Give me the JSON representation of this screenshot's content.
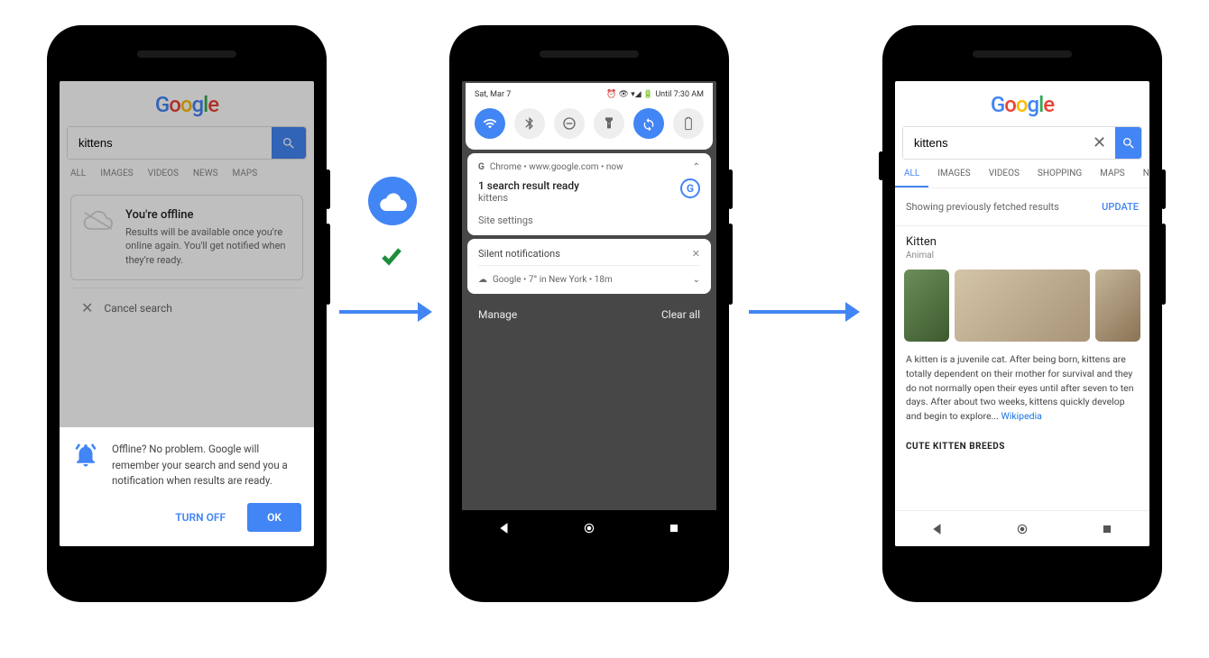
{
  "phone1": {
    "logo": "Google",
    "search_value": "kittens",
    "tabs": [
      "ALL",
      "IMAGES",
      "VIDEOS",
      "NEWS",
      "MAPS"
    ],
    "offline": {
      "title": "You're offline",
      "text": "Results will be available once you're online again. You'll get notified when they're ready."
    },
    "cancel": "Cancel search",
    "sheet": {
      "text": "Offline? No problem. Google will remember your search and send you a notification when results are ready.",
      "turn_off": "TURN OFF",
      "ok": "OK"
    }
  },
  "phone2": {
    "status_date": "Sat, Mar 7",
    "status_right": "⏰ 👁 ▾◢ 🔋 Until 7:30 AM",
    "notif": {
      "source": "Chrome • www.google.com • now",
      "title": "1 search result ready",
      "subtitle": "kittens",
      "site_settings": "Site settings"
    },
    "silent": {
      "header": "Silent notifications",
      "weather": "Google • 7° in New York • 18m"
    },
    "footer": {
      "manage": "Manage",
      "clear": "Clear all"
    }
  },
  "phone3": {
    "logo": "Google",
    "search_value": "kittens",
    "tabs": [
      "ALL",
      "IMAGES",
      "VIDEOS",
      "SHOPPING",
      "MAPS",
      "NEW"
    ],
    "info": {
      "text": "Showing previously fetched results",
      "update": "UPDATE"
    },
    "kc": {
      "title": "Kitten",
      "subtitle": "Animal",
      "desc": "A kitten is a juvenile cat. After being born, kittens are totally dependent on their mother for survival and they do not normally open their eyes until after seven to ten days. After about two weeks, kittens quickly develop and begin to explore... ",
      "link": "Wikipedia",
      "section": "CUTE KITTEN BREEDS"
    }
  }
}
